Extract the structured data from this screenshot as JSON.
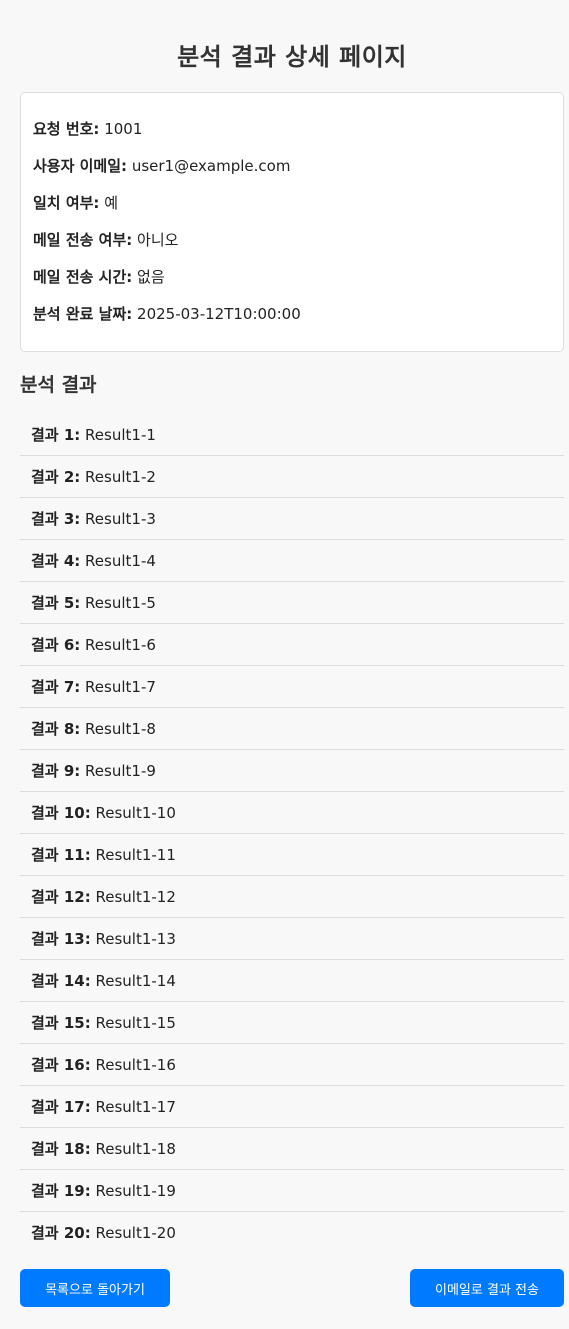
{
  "page": {
    "title": "분석 결과 상세 페이지"
  },
  "info": {
    "request_id": {
      "label": "요청 번호:",
      "value": "1001"
    },
    "user_email": {
      "label": "사용자 이메일:",
      "value": "user1@example.com"
    },
    "match": {
      "label": "일치 여부:",
      "value": "예"
    },
    "email_sent": {
      "label": "메일 전송 여부:",
      "value": "아니오"
    },
    "email_sent_time": {
      "label": "메일 전송 시간:",
      "value": "없음"
    },
    "completed_date": {
      "label": "분석 완료 날짜:",
      "value": "2025-03-12T10:00:00"
    }
  },
  "results": {
    "heading": "분석 결과",
    "items": [
      {
        "label": "결과 1:",
        "value": "Result1-1"
      },
      {
        "label": "결과 2:",
        "value": "Result1-2"
      },
      {
        "label": "결과 3:",
        "value": "Result1-3"
      },
      {
        "label": "결과 4:",
        "value": "Result1-4"
      },
      {
        "label": "결과 5:",
        "value": "Result1-5"
      },
      {
        "label": "결과 6:",
        "value": "Result1-6"
      },
      {
        "label": "결과 7:",
        "value": "Result1-7"
      },
      {
        "label": "결과 8:",
        "value": "Result1-8"
      },
      {
        "label": "결과 9:",
        "value": "Result1-9"
      },
      {
        "label": "결과 10:",
        "value": "Result1-10"
      },
      {
        "label": "결과 11:",
        "value": "Result1-11"
      },
      {
        "label": "결과 12:",
        "value": "Result1-12"
      },
      {
        "label": "결과 13:",
        "value": "Result1-13"
      },
      {
        "label": "결과 14:",
        "value": "Result1-14"
      },
      {
        "label": "결과 15:",
        "value": "Result1-15"
      },
      {
        "label": "결과 16:",
        "value": "Result1-16"
      },
      {
        "label": "결과 17:",
        "value": "Result1-17"
      },
      {
        "label": "결과 18:",
        "value": "Result1-18"
      },
      {
        "label": "결과 19:",
        "value": "Result1-19"
      },
      {
        "label": "결과 20:",
        "value": "Result1-20"
      }
    ]
  },
  "actions": {
    "back_label": "목록으로 돌아가기",
    "email_label": "이메일로 결과 전송"
  },
  "colors": {
    "accent": "#007bff",
    "background": "#f8f8f8",
    "card": "#ffffff",
    "border": "#dddddd"
  }
}
